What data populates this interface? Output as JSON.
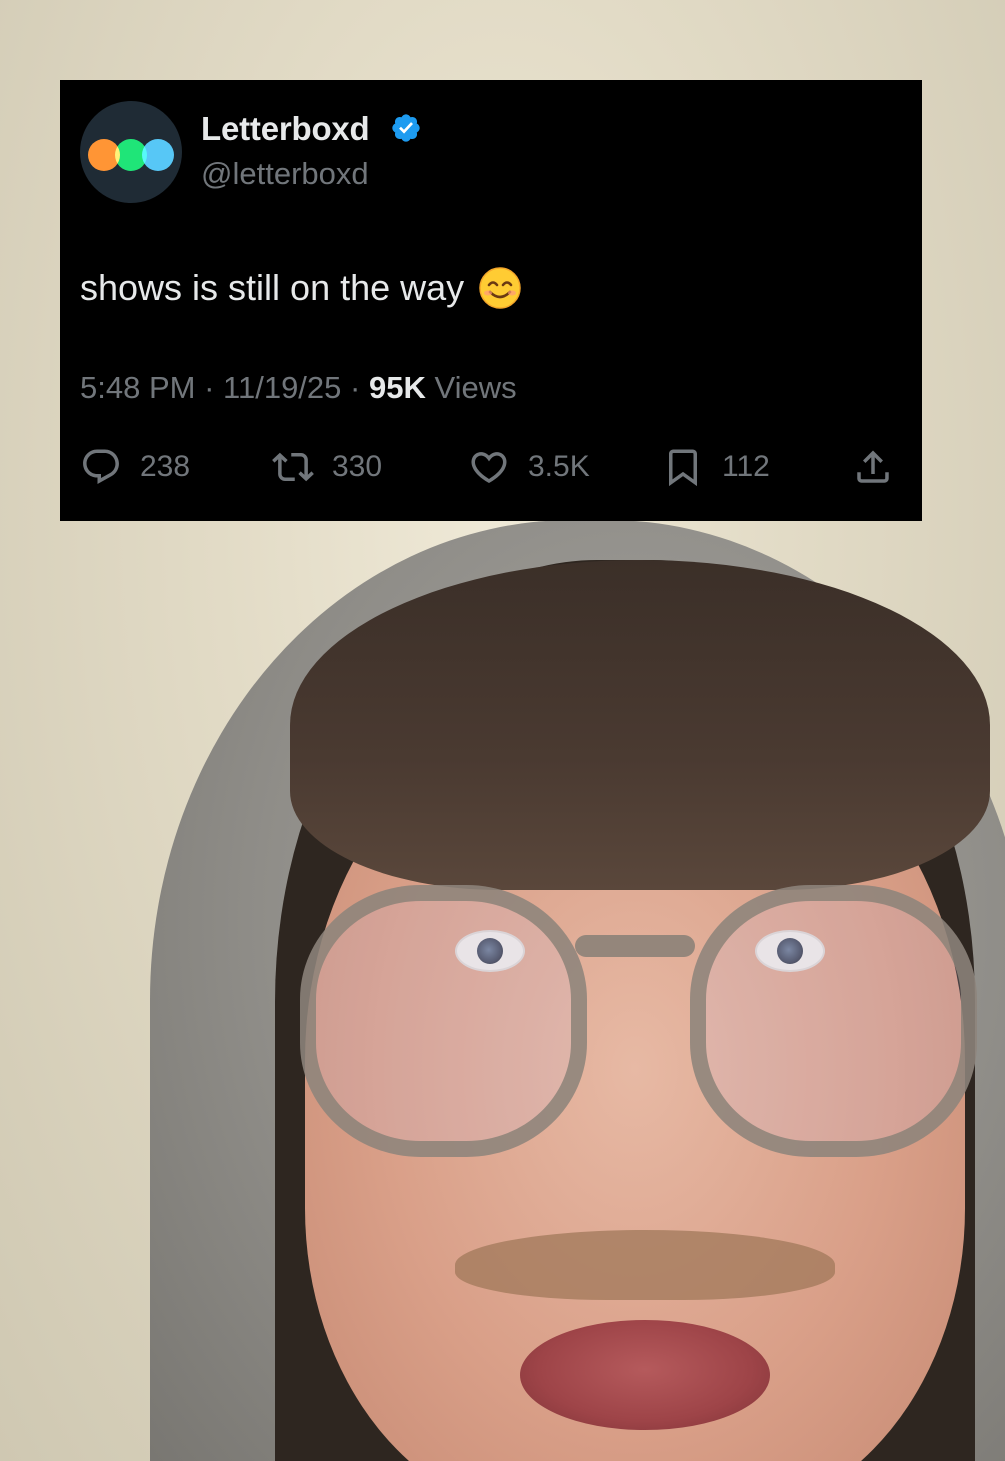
{
  "tweet": {
    "display_name": "Letterboxd",
    "handle": "@letterboxd",
    "verified": true,
    "text": "shows is still on the way",
    "emoji": "smiling-face-with-smiling-eyes",
    "time": "5:48 PM",
    "date": "11/19/25",
    "separator": "·",
    "views_count": "95K",
    "views_label": "Views",
    "replies": "238",
    "reposts": "330",
    "likes": "3.5K",
    "bookmarks": "112",
    "icons": {
      "reply": "reply-icon",
      "repost": "repost-icon",
      "like": "heart-icon",
      "bookmark": "bookmark-icon",
      "share": "share-icon",
      "verified": "verified-badge-icon"
    },
    "colors": {
      "card_background": "#000000",
      "primary_text": "#e7e9ea",
      "secondary_text": "#71767b",
      "verified_blue": "#1d9bf0",
      "logo_orange": "#ff8000",
      "logo_green": "#00e054",
      "logo_blue": "#40bcf4"
    }
  }
}
